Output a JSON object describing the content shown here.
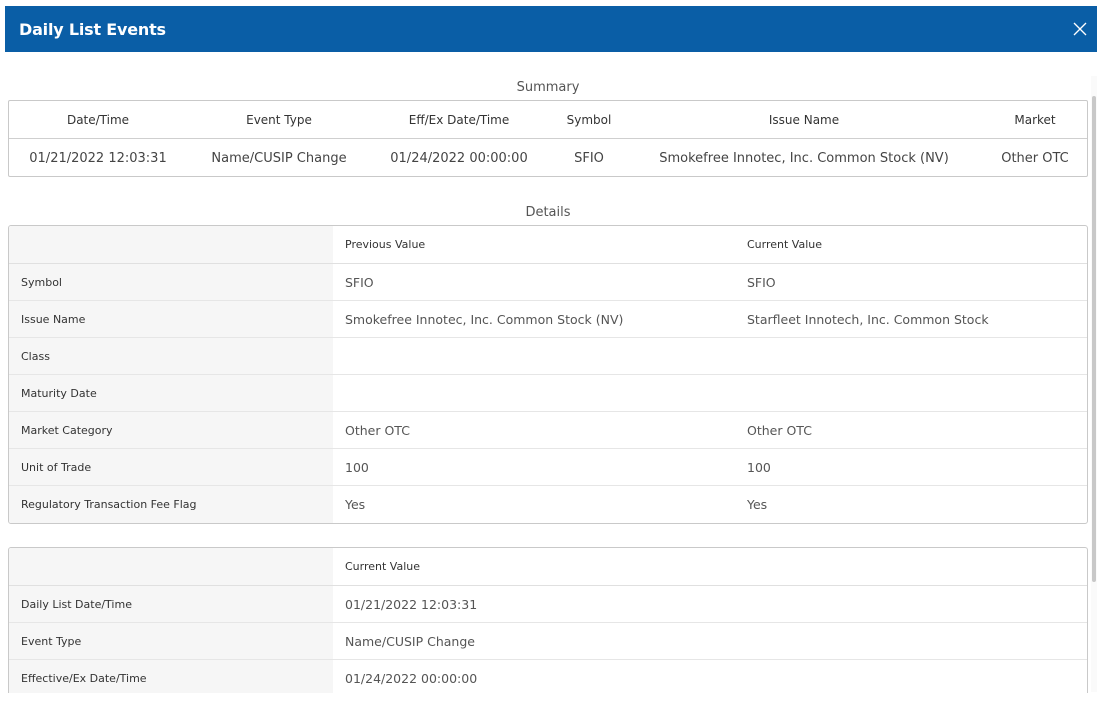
{
  "dialog": {
    "title": "Daily List Events",
    "close_icon": "close-icon"
  },
  "summary": {
    "title": "Summary",
    "columns": [
      "Date/Time",
      "Event Type",
      "Eff/Ex Date/Time",
      "Symbol",
      "Issue Name",
      "Market"
    ],
    "row": [
      "01/21/2022 12:03:31",
      "Name/CUSIP Change",
      "01/24/2022 00:00:00",
      "SFIO",
      "Smokefree Innotec, Inc. Common Stock (NV)",
      "Other OTC"
    ]
  },
  "details": {
    "title": "Details",
    "header": {
      "label": "",
      "previous": "Previous Value",
      "current": "Current Value"
    },
    "rows": [
      {
        "label": "Symbol",
        "previous": "SFIO",
        "current": "SFIO"
      },
      {
        "label": "Issue Name",
        "previous": "Smokefree Innotec, Inc. Common Stock (NV)",
        "current": "Starfleet Innotech, Inc. Common Stock"
      },
      {
        "label": "Class",
        "previous": "",
        "current": ""
      },
      {
        "label": "Maturity Date",
        "previous": "",
        "current": ""
      },
      {
        "label": "Market Category",
        "previous": "Other OTC",
        "current": "Other OTC"
      },
      {
        "label": "Unit of Trade",
        "previous": "100",
        "current": "100"
      },
      {
        "label": "Regulatory Transaction Fee Flag",
        "previous": "Yes",
        "current": "Yes"
      }
    ]
  },
  "event_info": {
    "header": {
      "label": "",
      "current": "Current Value"
    },
    "rows": [
      {
        "label": "Daily List Date/Time",
        "current": "01/21/2022 12:03:31"
      },
      {
        "label": "Event Type",
        "current": "Name/CUSIP Change"
      },
      {
        "label": "Effective/Ex Date/Time",
        "current": "01/24/2022 00:00:00"
      }
    ]
  },
  "colors": {
    "titlebar": "#0a5ea6",
    "label_bg": "#f6f6f6",
    "border": "#c9c9c9"
  }
}
